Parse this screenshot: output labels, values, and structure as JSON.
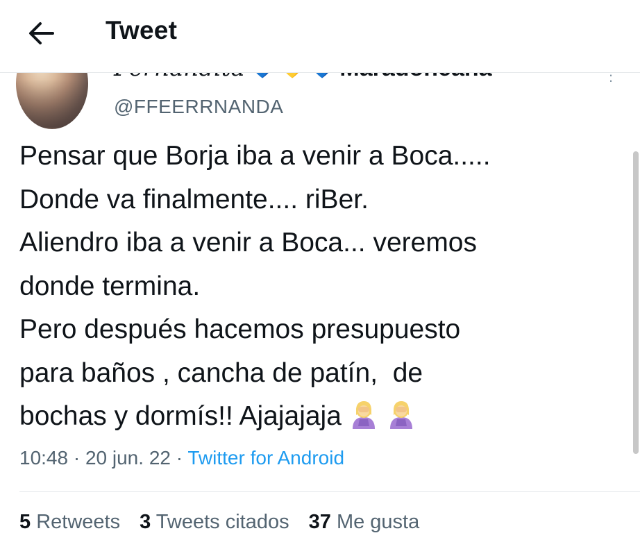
{
  "header": {
    "title": "Tweet",
    "back_icon": "arrow-left-icon"
  },
  "user": {
    "display_name_left": "Fernandita",
    "display_name_right": "Maradoneana",
    "hearts": [
      "💙",
      "💛",
      "💙"
    ],
    "handle": "@FFEERRNANDA",
    "more_icon": "more-vertical-icon"
  },
  "tweet": {
    "lines": [
      "Pensar que Borja iba a venir a Boca.....",
      "Donde va finalmente.... riBer.",
      "Aliendro iba a venir a Boca... veremos",
      "donde termina.",
      "Pero después hacemos presupuesto",
      "para baños , cancha de patín,  de",
      "bochas y dormís!! Ajajajaja"
    ],
    "emojis": [
      "woman-facepalming-icon",
      "woman-facepalming-icon"
    ]
  },
  "meta": {
    "time": "10:48",
    "sep1": " · ",
    "date": "20 jun. 22",
    "sep2": " · ",
    "source": "Twitter for Android"
  },
  "stats": {
    "retweets_count": "5",
    "retweets_label": "Retweets",
    "quotes_count": "3",
    "quotes_label": "Tweets citados",
    "likes_count": "37",
    "likes_label": "Me gusta"
  },
  "colors": {
    "accent": "#1d9bf0",
    "secondary_text": "#536471",
    "primary_text": "#0f1419"
  }
}
